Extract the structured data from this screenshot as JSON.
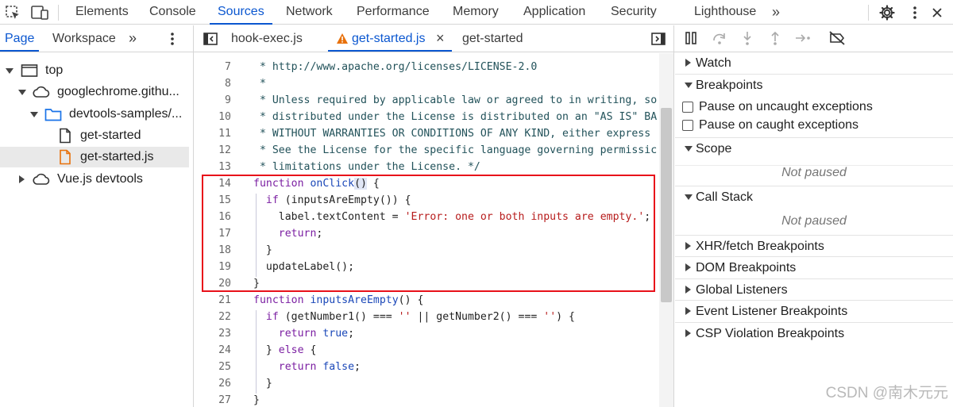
{
  "toolbar": {
    "tabs": [
      "Elements",
      "Console",
      "Sources",
      "Network",
      "Performance",
      "Memory",
      "Application",
      "Security",
      "Lighthouse"
    ],
    "more": "»"
  },
  "navigator": {
    "tabs": [
      "Page",
      "Workspace"
    ],
    "more": "»",
    "tree": [
      {
        "label": "top",
        "icon": "frame-icon"
      },
      {
        "label": "googlechrome.githu...",
        "icon": "cloud-icon"
      },
      {
        "label": "devtools-samples/...",
        "icon": "folder-icon"
      },
      {
        "label": "get-started",
        "icon": "document-icon"
      },
      {
        "label": "get-started.js",
        "icon": "js-file-icon"
      },
      {
        "label": "Vue.js devtools",
        "icon": "cloud-icon"
      }
    ]
  },
  "editor": {
    "tabs": [
      {
        "label": "hook-exec.js"
      },
      {
        "label": "get-started.js",
        "warning": true,
        "close": "×"
      },
      {
        "label": "get-started"
      }
    ],
    "line_numbers": [
      "7",
      "8",
      "9",
      "10",
      "11",
      "12",
      "13",
      "14",
      "15",
      "16",
      "17",
      "18",
      "19",
      "20",
      "21",
      "22",
      "23",
      "24",
      "25",
      "26",
      "27"
    ],
    "code": {
      "l7": " * http://www.apache.org/licenses/LICENSE-2.0",
      "l8": " *",
      "l9": " * Unless required by applicable law or agreed to in writing, so",
      "l10": " * distributed under the License is distributed on an \"AS IS\" BA",
      "l11": " * WITHOUT WARRANTIES OR CONDITIONS OF ANY KIND, either express",
      "l12": " * See the License for the specific language governing permissic",
      "l13": " * limitations under the License. */",
      "l14_kw": "function",
      "l14_fn": "onClick",
      "l14_paren": "()",
      "l14_rest": " {",
      "l15_kw": "if",
      "l15_rest": " (inputsAreEmpty()) {",
      "l16_a": "label.textContent = ",
      "l16_str": "'Error: one or both inputs are empty.'",
      "l16_b": ";",
      "l17_kw": "return",
      "l17_b": ";",
      "l18": "}",
      "l19": "updateLabel();",
      "l20": "}",
      "l21_kw": "function",
      "l21_fn": "inputsAreEmpty",
      "l21_rest": "() {",
      "l22_kw": "if",
      "l22_a": " (getNumber1() === ",
      "l22_s1": "''",
      "l22_b": " || getNumber2() === ",
      "l22_s2": "''",
      "l22_c": ") {",
      "l23_kw": "return",
      "l23_v": " true",
      "l23_b": ";",
      "l24_a": "} ",
      "l24_kw": "else",
      "l24_b": " {",
      "l25_kw": "return",
      "l25_v": " false",
      "l25_b": ";",
      "l26": "}",
      "l27": "}"
    }
  },
  "debugger": {
    "sections": {
      "watch": "Watch",
      "breakpoints": "Breakpoints",
      "pause_uncaught": "Pause on uncaught exceptions",
      "pause_caught": "Pause on caught exceptions",
      "scope": "Scope",
      "scope_status": "Not paused",
      "callstack": "Call Stack",
      "callstack_status": "Not paused",
      "xhr": "XHR/fetch Breakpoints",
      "dom": "DOM Breakpoints",
      "global": "Global Listeners",
      "event": "Event Listener Breakpoints",
      "csp": "CSP Violation Breakpoints"
    }
  },
  "watermark": "CSDN @南木元元",
  "colors": {
    "accent": "#0b57d0",
    "highlight_box": "#e8101a",
    "warning": "#e8710a"
  }
}
